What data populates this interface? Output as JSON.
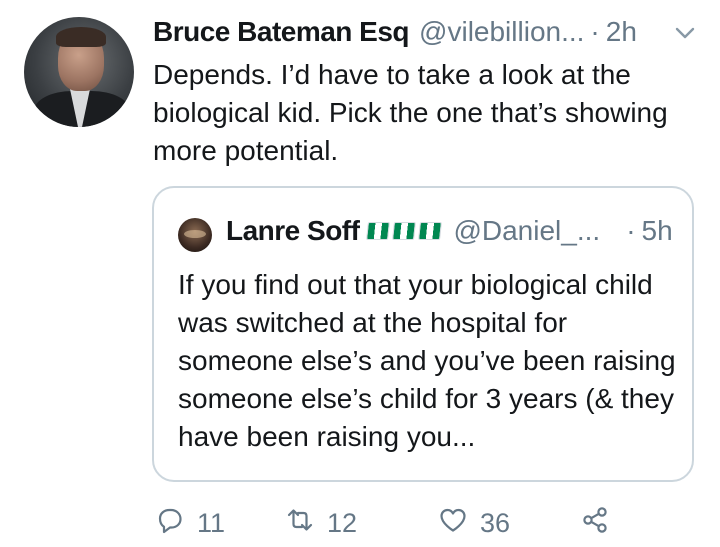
{
  "tweet": {
    "display_name": "Bruce Bateman Esq",
    "handle": "@vilebillion...",
    "separator": "·",
    "time": "2h",
    "text": "Depends. I’d have to take a look at the biological kid. Pick the one that’s showing more potential."
  },
  "quoted_tweet": {
    "display_name": "Lanre Soff",
    "handle": "@Daniel_...",
    "separator": "·",
    "time": "5h",
    "text": "If you find out that your biological child was switched at the hospital for someone else’s and you’ve been raising someone else’s child for 3 years (& they have been raising you...",
    "flag_icons": [
      "nigeria-flag-icon",
      "nigeria-flag-icon",
      "nigeria-flag-icon"
    ]
  },
  "actions": {
    "reply_count": "11",
    "retweet_count": "12",
    "like_count": "36"
  },
  "icons": {
    "reply": "reply-icon",
    "retweet": "retweet-icon",
    "like": "heart-icon",
    "share": "share-icon",
    "menu": "chevron-down-icon"
  },
  "colors": {
    "text": "#14171a",
    "secondary": "#657786",
    "border": "#ccd6dd"
  }
}
